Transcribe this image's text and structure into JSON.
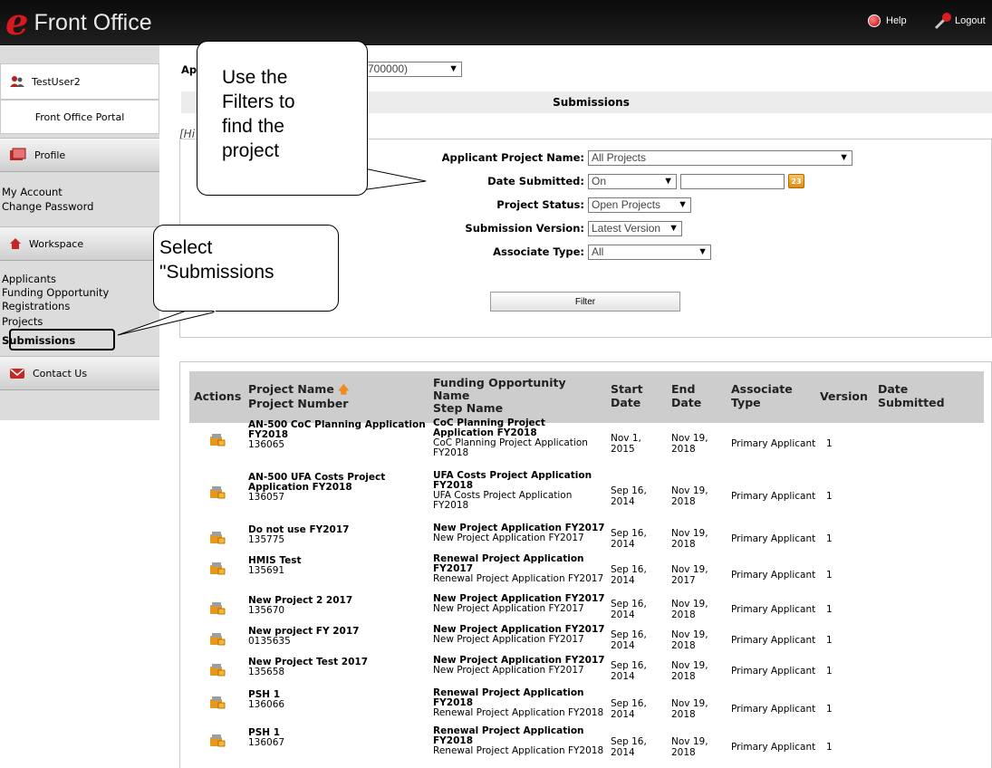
{
  "header": {
    "logo_letter": "e",
    "app_name": "Front Office",
    "help_label": "Help",
    "logout_label": "Logout"
  },
  "sidebar": {
    "user": "TestUser2",
    "portal": "Front Office Portal",
    "profile": "Profile",
    "my_account": "My Account",
    "change_password": "Change Password",
    "workspace": "Workspace",
    "applicants": "Applicants",
    "funding_registrations": "Funding Opportunity Registrations",
    "projects": "Projects",
    "submissions": "Submissions",
    "contact": "Contact Us"
  },
  "main": {
    "applicant_label": "Ap",
    "applicant_value": "700000)",
    "submissions_title": "Submissions",
    "hide_link": "[Hi"
  },
  "filters": {
    "project_name": {
      "label": "Applicant Project Name:",
      "value": "All Projects"
    },
    "date_submitted": {
      "label": "Date Submitted:",
      "value": "On",
      "date_value": "",
      "calendar_text": "23"
    },
    "project_status": {
      "label": "Project Status:",
      "value": "Open Projects"
    },
    "submission_version": {
      "label": "Submission Version:",
      "value": "Latest Version"
    },
    "associate_type": {
      "label": "Associate Type:",
      "value": "All"
    },
    "filter_button": "Filter"
  },
  "table": {
    "headers": {
      "actions": "Actions",
      "project_name": "Project Name",
      "project_number": "Project Number",
      "funding_1": "Funding Opportunity",
      "funding_2": "Name",
      "step_name": "Step Name",
      "start_1": "Start",
      "start_2": "Date",
      "end_1": "End",
      "end_2": "Date",
      "assoc_1": "Associate",
      "assoc_2": "Type",
      "version": "Version",
      "date_sub_1": "Date",
      "date_sub_2": "Submitted"
    },
    "rows": [
      {
        "name": [
          "AN-500 CoC Planning Application",
          "FY2018"
        ],
        "number": "136065",
        "funding": [
          "CoC Planning Project",
          "Application FY2018"
        ],
        "step": [
          "CoC Planning Project Application",
          "FY2018"
        ],
        "start": [
          "Nov 1,",
          "2015"
        ],
        "end": [
          "Nov 19,",
          "2018"
        ],
        "assoc": "Primary Applicant",
        "version": "1",
        "submitted": ""
      },
      {
        "name": [
          "AN-500 UFA Costs Project",
          "Application FY2018"
        ],
        "number": "136057",
        "funding": [
          "UFA Costs Project Application",
          "FY2018"
        ],
        "step": [
          "UFA Costs Project Application",
          "FY2018"
        ],
        "start": [
          "Sep 16,",
          "2014"
        ],
        "end": [
          "Nov 19,",
          "2018"
        ],
        "assoc": "Primary Applicant",
        "version": "1",
        "submitted": ""
      },
      {
        "name": [
          "Do not use FY2017"
        ],
        "number": "135775",
        "funding": [
          "New Project Application FY2017"
        ],
        "step": [
          "New Project Application FY2017"
        ],
        "start": [
          "Sep 16,",
          "2014"
        ],
        "end": [
          "Nov 19,",
          "2018"
        ],
        "assoc": "Primary Applicant",
        "version": "1",
        "submitted": ""
      },
      {
        "name": [
          "HMIS Test"
        ],
        "number": "135691",
        "funding": [
          "Renewal Project Application",
          "FY2017"
        ],
        "step": [
          "Renewal Project Application FY2017"
        ],
        "start": [
          "Sep 16,",
          "2014"
        ],
        "end": [
          "Nov 19,",
          "2017"
        ],
        "assoc": "Primary Applicant",
        "version": "1",
        "submitted": ""
      },
      {
        "name": [
          "New Project 2 2017"
        ],
        "number": "135670",
        "funding": [
          "New Project Application FY2017"
        ],
        "step": [
          "New Project Application FY2017"
        ],
        "start": [
          "Sep 16,",
          "2014"
        ],
        "end": [
          "Nov 19,",
          "2018"
        ],
        "assoc": "Primary Applicant",
        "version": "1",
        "submitted": ""
      },
      {
        "name": [
          "New project FY 2017"
        ],
        "number": "0135635",
        "funding": [
          "New Project Application FY2017"
        ],
        "step": [
          "New Project Application FY2017"
        ],
        "start": [
          "Sep 16,",
          "2014"
        ],
        "end": [
          "Nov 19,",
          "2018"
        ],
        "assoc": "Primary Applicant",
        "version": "1",
        "submitted": ""
      },
      {
        "name": [
          "New Project Test 2017"
        ],
        "number": "135658",
        "funding": [
          "New Project Application FY2017"
        ],
        "step": [
          "New Project Application FY2017"
        ],
        "start": [
          "Sep 16,",
          "2014"
        ],
        "end": [
          "Nov 19,",
          "2018"
        ],
        "assoc": "Primary Applicant",
        "version": "1",
        "submitted": ""
      },
      {
        "name": [
          "PSH 1"
        ],
        "number": "136066",
        "funding": [
          "Renewal Project Application",
          "FY2018"
        ],
        "step": [
          "Renewal Project Application FY2018"
        ],
        "start": [
          "Sep 16,",
          "2014"
        ],
        "end": [
          "Nov 19,",
          "2018"
        ],
        "assoc": "Primary Applicant",
        "version": "1",
        "submitted": ""
      },
      {
        "name": [
          "PSH 1"
        ],
        "number": "136067",
        "funding": [
          "Renewal Project Application",
          "FY2018"
        ],
        "step": [
          "Renewal Project Application FY2018"
        ],
        "start": [
          "Sep 16,",
          "2014"
        ],
        "end": [
          "Nov 19,",
          "2018"
        ],
        "assoc": "Primary Applicant",
        "version": "1",
        "submitted": ""
      }
    ]
  },
  "callouts": {
    "filters": [
      "Use the",
      "Filters to",
      "find the",
      "project"
    ],
    "submissions": [
      "Select",
      "\"Submissions"
    ]
  },
  "colors": {
    "brand_red": "#d7191e",
    "accent_orange": "#f08a1c",
    "header_bg": "#0b0b0b"
  },
  "icons": [
    "help-icon",
    "key-icon",
    "user-icon",
    "profile-icon",
    "home-icon",
    "envelope-icon",
    "calendar-icon",
    "folder-lock-icon",
    "sort-arrow-icon",
    "chevron-down-icon"
  ]
}
